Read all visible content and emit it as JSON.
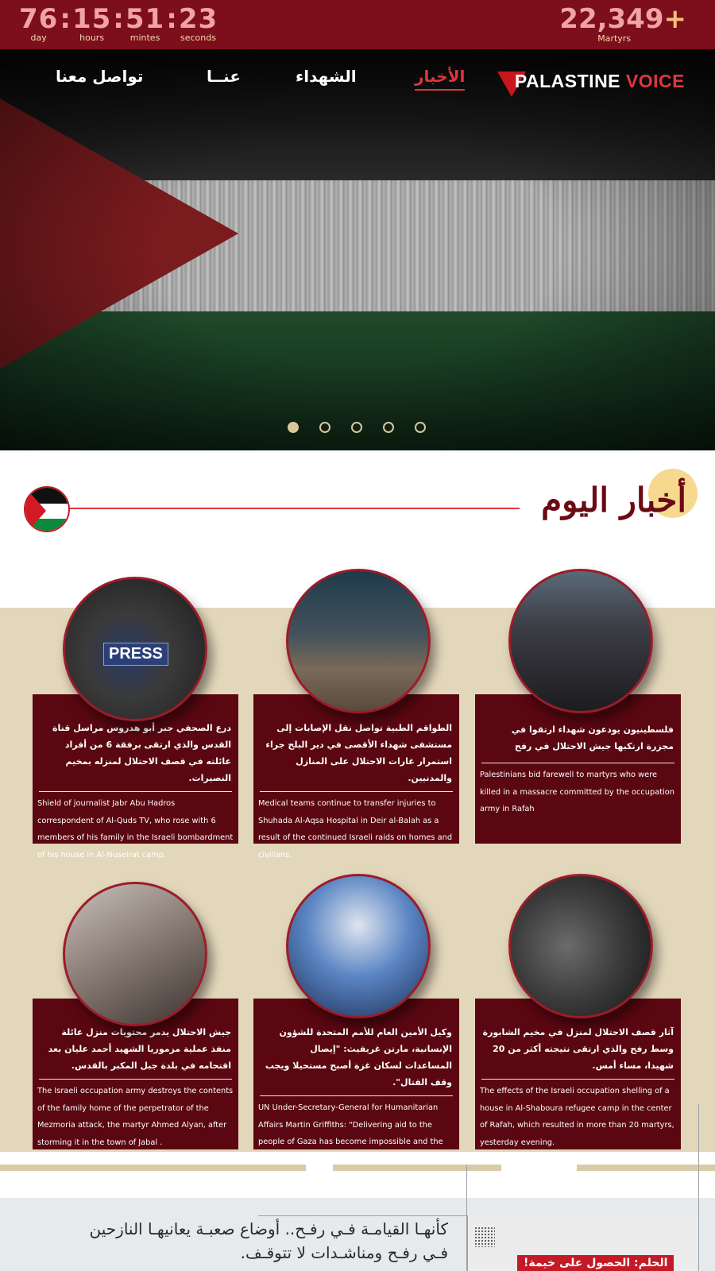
{
  "counter": {
    "days": "76",
    "hours": "15",
    "minutes": "51",
    "seconds": "23",
    "day_label": "day",
    "hours_label": "hours",
    "minutes_label": "mintes",
    "seconds_label": "seconds",
    "martyrs_count": "22,349",
    "martyrs_plus": "+",
    "martyrs_label": "Martyrs"
  },
  "nav": {
    "news": "الأخبار",
    "martyrs": "الشهداء",
    "about": "عنــا",
    "contact": "تواصل معنا"
  },
  "logo": {
    "palestine": "PALASTINE",
    "voice": "VOICE"
  },
  "slider": {
    "slide_count": 5,
    "active_index": 0
  },
  "section": {
    "title": "أخبار اليوم"
  },
  "news": [
    {
      "ar": "درع الصحفي جبر أبو هدروس مراسل قناة القدس والذي ارتقى برفقة 6 من أفراد عائلته في قصف الاحتلال لمنزله بمخيم النصيرات.",
      "en": "Shield of journalist Jabr Abu Hadros correspondent of Al-Quds TV, who rose with 6 members of his family in the Israeli bombardment of his house in Al-Nuseirat camp.",
      "image_label": "PRESS"
    },
    {
      "ar": "الطواقم الطبية تواصل نقل الإصابات إلى مستشفى شهداء الأقصى في دير البلح جراء استمرار غارات الاحتلال على المنازل والمدنيين.",
      "en": "Medical teams continue to transfer injuries to Shuhada Al-Aqsa Hospital in Deir al-Balah as a result of the continued Israeli raids on homes and civilians."
    },
    {
      "ar": "فلسطينيون يودعون شهداء ارتقوا في مجزرة ارتكبها جيش الاحتلال في رفح",
      "en": "Palestinians bid farewell to martyrs who were killed in a massacre committed by the occupation army in Rafah"
    },
    {
      "ar": "جيش الاحتلال يدمر محتويات منزل عائلة منفذ عملية مزموريا الشهيد أحمد عليان بعد اقتحامه في بلدة جبل المكبر بالقدس.",
      "en": "The Israeli occupation army destroys the contents of the family home of the perpetrator of the Mezmoria attack, the martyr Ahmed Alyan, after storming it in the town of Jabal ."
    },
    {
      "ar": "وكيل الأمين العام للأمم المتحدة للشؤون الإنسانية، مارتن غريفيث: \"إيصال المساعدات لسكان غزة أصبح مستحيلا ويجب وقف القتال\".",
      "en": "UN Under-Secretary-General for Humanitarian Affairs Martin Griffiths: \"Delivering aid to the people of Gaza has become impossible and the fighting must stop.\""
    },
    {
      "ar": "آثار قصف الاحتلال لمنزل في مخيم الشابورة وسط رفح والذي ارتقى نتيجته أكثر من 20 شهيدا، مساء أمس.",
      "en": "The effects of the Israeli occupation shelling of a house in Al-Shaboura refugee camp in the center of Rafah, which resulted in more than 20 martyrs, yesterday evening."
    }
  ],
  "bottom": {
    "headline": "كأنهـا القيامـة فـي رفـح.. أوضاع صعبـة يعانيهـا النازحين فـي رفـح ومناشـدات لا تتوقـف.",
    "image_tag": "الحلم: الحصول على خيمة!"
  },
  "colors": {
    "topbar": "#7d0e1c",
    "accent_red": "#e2353c",
    "card_bg": "#5a0711",
    "band_bg": "#e3d7bb",
    "title_color": "#6b0a14"
  }
}
